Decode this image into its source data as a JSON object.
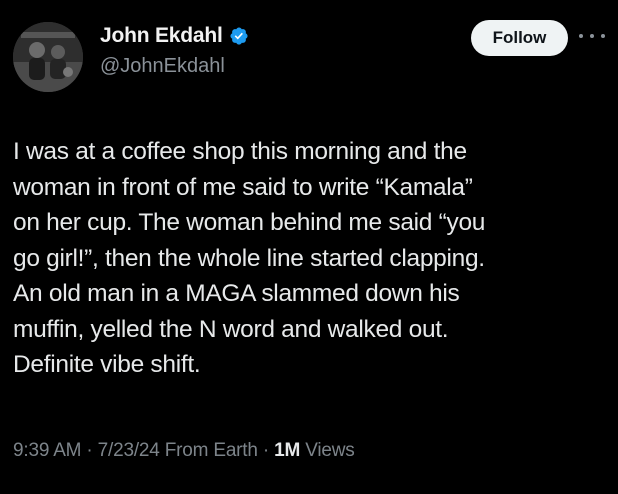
{
  "author": {
    "display_name": "John Ekdahl",
    "handle": "@JohnEkdahl",
    "verified_icon": "verified-badge-icon",
    "avatar_icon": "profile-photo"
  },
  "header": {
    "follow_label": "Follow",
    "more_icon": "more-options-icon"
  },
  "tweet": {
    "lines": [
      "I was at a coffee shop this morning and the",
      "woman in front of me said to write “Kamala”",
      "on her cup. The woman behind me said “you",
      "go girl!”, then the whole line started clapping.",
      "An old man in a MAGA slammed down his",
      "muffin, yelled the N word and walked out.",
      "Definite vibe shift."
    ]
  },
  "meta": {
    "time": "9:39 AM",
    "separator": "·",
    "date": "7/23/24",
    "source": "From Earth",
    "views_count": "1M",
    "views_label": "Views"
  },
  "colors": {
    "background": "#000000",
    "text": "#e7e9ea",
    "secondary_text": "#8b9299",
    "verified": "#1d9bf0",
    "follow_bg": "#eff3f4"
  }
}
